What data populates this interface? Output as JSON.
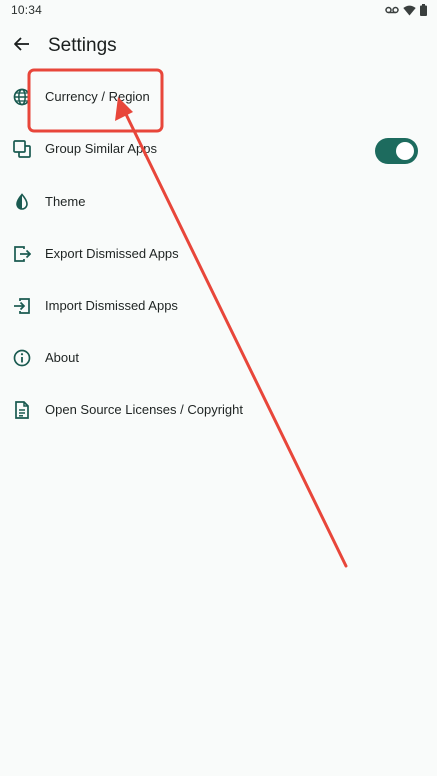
{
  "status_bar": {
    "time": "10:34",
    "icons": [
      "voicemail-icon",
      "wifi-icon",
      "battery-icon"
    ]
  },
  "header": {
    "title": "Settings",
    "back_icon": "arrow-back-icon"
  },
  "settings": {
    "items": [
      {
        "label": "Currency / Region",
        "icon": "globe-icon"
      },
      {
        "label": "Group Similar Apps",
        "icon": "copy-icon",
        "toggle_on": true
      },
      {
        "label": "Theme",
        "icon": "contrast-icon"
      },
      {
        "label": "Export Dismissed Apps",
        "icon": "export-icon"
      },
      {
        "label": "Import Dismissed Apps",
        "icon": "import-icon"
      },
      {
        "label": "About",
        "icon": "info-icon"
      },
      {
        "label": "Open Source Licenses / Copyright",
        "icon": "document-icon"
      }
    ]
  },
  "colors": {
    "accent": "#1d6b5e",
    "icon": "#1a5a50",
    "background": "#f9fbfa",
    "annotation": "#e8463a"
  }
}
